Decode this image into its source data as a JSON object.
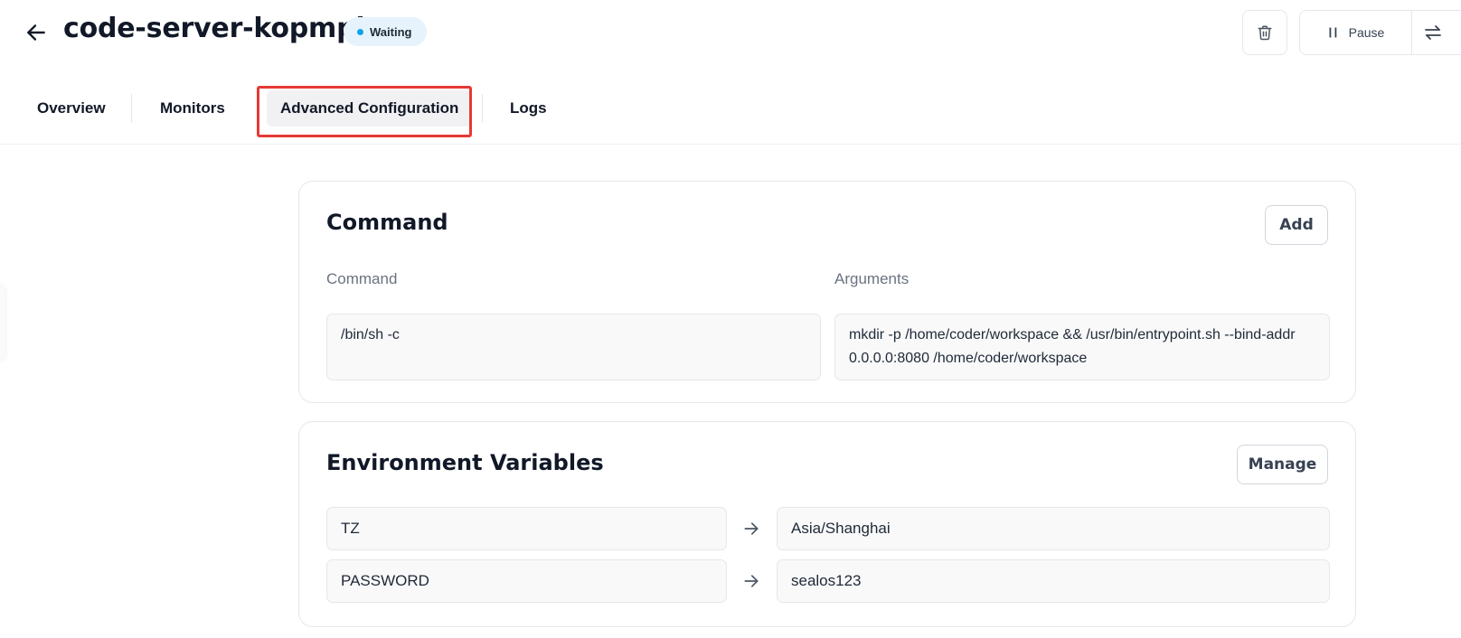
{
  "header": {
    "title": "code-server-kopmplst",
    "status": "Waiting",
    "back_icon": "arrow-left-icon",
    "trash_icon": "trash-icon",
    "pause_label": "Pause",
    "pause_icon": "pause-icon",
    "switch_icon": "swap-icon"
  },
  "tabs": [
    {
      "label": "Overview",
      "active": false
    },
    {
      "label": "Monitors",
      "active": false
    },
    {
      "label": "Advanced Configuration",
      "active": true
    },
    {
      "label": "Logs",
      "active": false
    }
  ],
  "command_card": {
    "title": "Command",
    "add_label": "Add",
    "command_label": "Command",
    "arguments_label": "Arguments",
    "command_value": "/bin/sh -c",
    "arguments_value": "mkdir -p /home/coder/workspace && /usr/bin/entrypoint.sh --bind-addr 0.0.0.0:8080 /home/coder/workspace"
  },
  "env_card": {
    "title": "Environment Variables",
    "manage_label": "Manage",
    "vars": [
      {
        "key": "TZ",
        "value": "Asia/Shanghai"
      },
      {
        "key": "PASSWORD",
        "value": "sealos123"
      }
    ]
  },
  "colors": {
    "accent_status_dot": "#0ea5e9",
    "status_bg": "#e6f3fc",
    "highlight_red": "#e53935"
  }
}
